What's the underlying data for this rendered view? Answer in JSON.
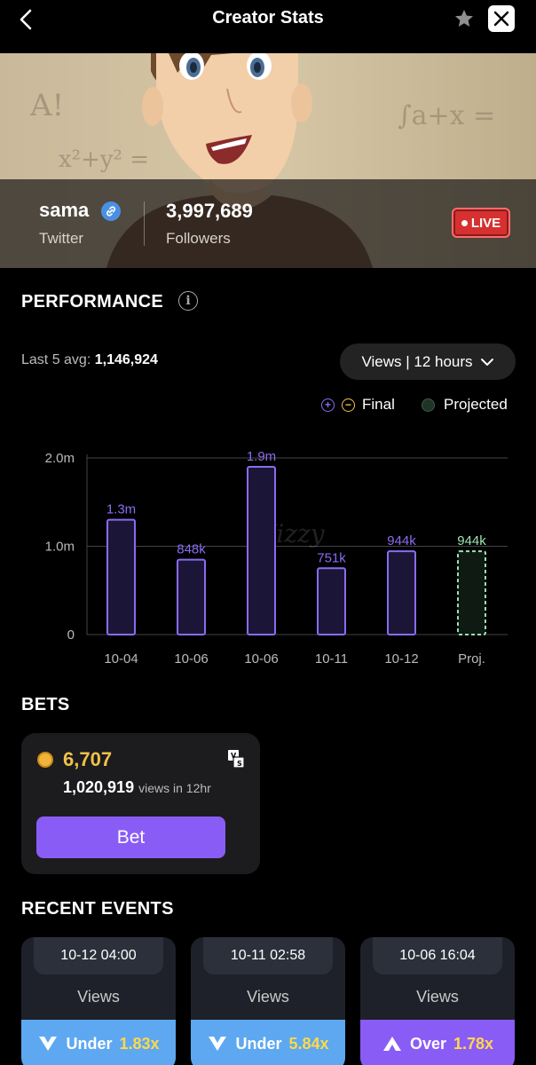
{
  "header": {
    "title": "Creator Stats"
  },
  "creator": {
    "name": "sama",
    "platform": "Twitter",
    "followers": "3,997,689",
    "followers_label": "Followers",
    "live_label": "LIVE"
  },
  "banner": {
    "board_text": [
      "A!",
      "x²+y² =",
      "∫a+x ="
    ]
  },
  "performance": {
    "title": "PERFORMANCE",
    "avg_label": "Last 5 avg:",
    "avg_value": "1,146,924",
    "dropdown_label": "Views | 12 hours",
    "legend_final": "Final",
    "legend_projected": "Projected"
  },
  "chart_data": {
    "type": "bar",
    "categories": [
      "10-04",
      "10-06",
      "10-06",
      "10-11",
      "10-12",
      "Proj."
    ],
    "values": [
      1300000,
      848000,
      1900000,
      751000,
      944000,
      944000
    ],
    "labels": [
      "1.3m",
      "848k",
      "1.9m",
      "751k",
      "944k",
      "944k"
    ],
    "projected": [
      false,
      false,
      false,
      false,
      false,
      true
    ],
    "yticks": [
      "0",
      "1.0m",
      "2.0m"
    ],
    "ylim": [
      0,
      2000000
    ],
    "watermark": "Kizzy",
    "colors": {
      "final": "#8a6cf0",
      "final_fill": "#1b1638",
      "projected": "#9be3b0",
      "projected_fill": "#0f1a12"
    }
  },
  "bets": {
    "title": "BETS",
    "coins": "6,707",
    "views": "1,020,919",
    "views_suffix": "views in 12hr",
    "button_label": "Bet"
  },
  "recent": {
    "title": "RECENT EVENTS",
    "events": [
      {
        "date": "10-12 04:00",
        "metric": "Views",
        "result": "Under",
        "multiplier": "1.83x",
        "kind": "under"
      },
      {
        "date": "10-11 02:58",
        "metric": "Views",
        "result": "Under",
        "multiplier": "5.84x",
        "kind": "under"
      },
      {
        "date": "10-06 16:04",
        "metric": "Views",
        "result": "Over",
        "multiplier": "1.78x",
        "kind": "over"
      }
    ]
  }
}
